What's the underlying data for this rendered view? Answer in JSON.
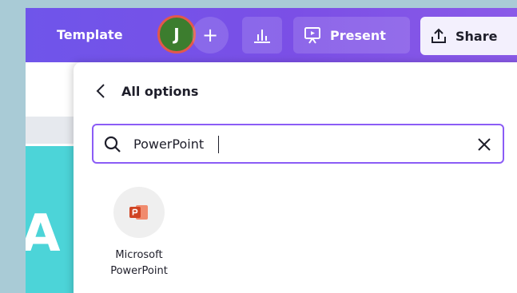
{
  "toolbar": {
    "template_label": "Template",
    "avatar_initial": "J",
    "add_label": "+",
    "present_label": "Present",
    "share_label": "Share"
  },
  "canvas": {
    "visible_letter": "A"
  },
  "panel": {
    "title": "All options",
    "search": {
      "value": "PowerPoint",
      "placeholder": ""
    },
    "results": [
      {
        "line1": "Microsoft",
        "line2": "PowerPoint",
        "icon": "powerpoint-icon"
      }
    ]
  },
  "colors": {
    "toolbar": "#7b4fe6",
    "avatar": "#3c7d2e",
    "avatar_ring": "#e2584b",
    "search_border": "#8b5cf6",
    "canvas_teal": "#4cd4d8",
    "powerpoint": "#d04423"
  }
}
